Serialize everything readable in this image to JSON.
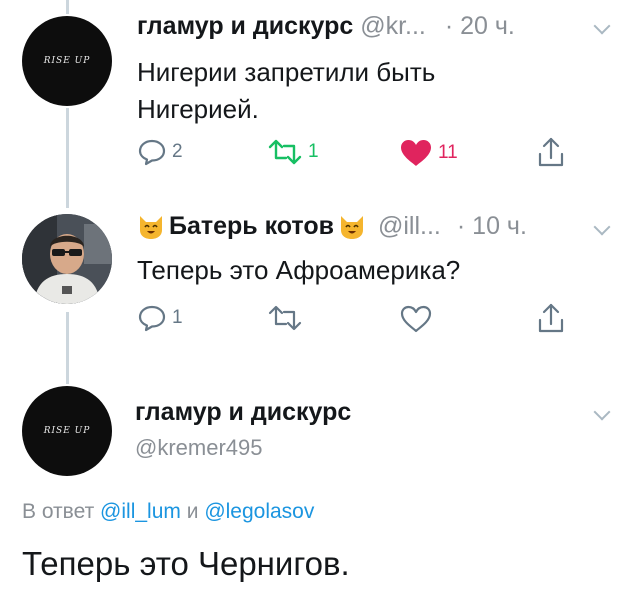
{
  "tweet1": {
    "author": "гламур и дискурс",
    "handle": "@kr...",
    "time": "· 20 ч.",
    "text_line1": "Нигерии запретили быть",
    "text_line2": "Нигерией.",
    "avatar_logo": "RISE UP",
    "reply_count": "2",
    "retweet_count": "1",
    "like_count": "11"
  },
  "tweet2": {
    "author": "Батерь котов",
    "handle": "@ill...",
    "time": "· 10 ч.",
    "text": "Теперь это Афроамерика?",
    "reply_count": "1"
  },
  "tweet3": {
    "author": "гламур и дискурс",
    "handle": "@kremer495",
    "avatar_logo": "RISE UP",
    "reply_prefix": "В ответ",
    "reply_user1": "@ill_lum",
    "reply_conj": "и",
    "reply_user2": "@legolasov",
    "text": "Теперь это Чернигов."
  },
  "colors": {
    "like": "#e0245e",
    "retweet": "#17bf63",
    "link": "#1b95e0",
    "muted": "#8a8f95",
    "thread_line": "#ccd6dd"
  },
  "icons": [
    "reply-icon",
    "retweet-icon",
    "like-icon",
    "share-icon",
    "chevron-down-icon",
    "cat-emoji-icon"
  ]
}
